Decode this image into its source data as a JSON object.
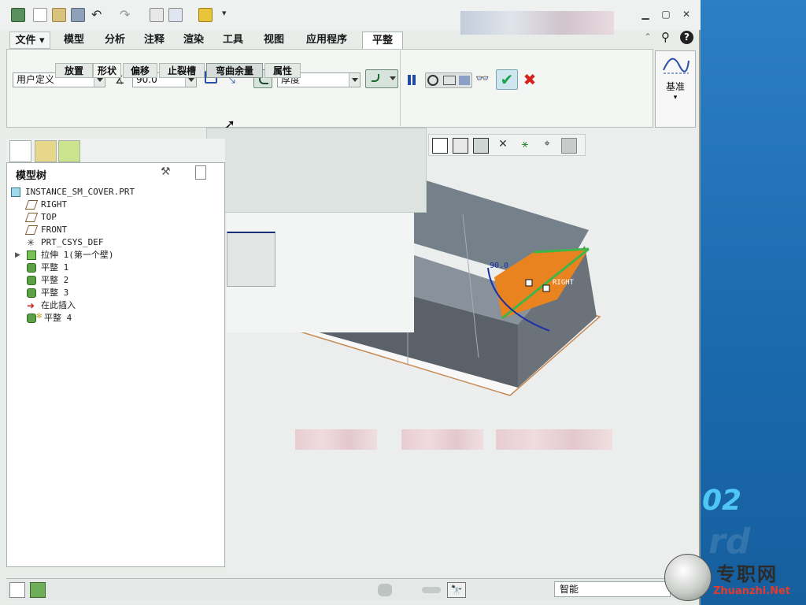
{
  "ribbon": {
    "tabs": [
      {
        "label": "文件",
        "dropdown": true
      },
      {
        "label": "模型"
      },
      {
        "label": "分析"
      },
      {
        "label": "注释"
      },
      {
        "label": "渲染"
      },
      {
        "label": "工具"
      },
      {
        "label": "视图"
      },
      {
        "label": "应用程序"
      },
      {
        "label": "平整",
        "active": true
      }
    ],
    "bend_type_value": "用户定义",
    "angle_value": "90.0",
    "thickness_value": "厚度",
    "subtabs": [
      "放置",
      "形状",
      "偏移",
      "止裂槽",
      "弯曲余量",
      "属性"
    ],
    "datum_label": "基准"
  },
  "model_tree": {
    "title": "模型树",
    "items": [
      {
        "label": "INSTANCE_SM_COVER.PRT",
        "icon": "part-icon"
      },
      {
        "label": "RIGHT",
        "icon": "datum-plane-icon"
      },
      {
        "label": "TOP",
        "icon": "datum-plane-icon"
      },
      {
        "label": "FRONT",
        "icon": "datum-plane-icon"
      },
      {
        "label": "PRT_CSYS_DEF",
        "icon": "csys-icon"
      },
      {
        "label": "拉伸 1(第一个壁)",
        "icon": "extrude-icon",
        "expandable": true
      },
      {
        "label": "平整 1",
        "icon": "flat-wall-icon"
      },
      {
        "label": "平整 2",
        "icon": "flat-wall-icon"
      },
      {
        "label": "平整 3",
        "icon": "flat-wall-icon"
      },
      {
        "label": "在此插入",
        "icon": "insert-here-icon"
      },
      {
        "label": "平整 4",
        "icon": "flat-wall-icon",
        "new": true
      }
    ]
  },
  "graphics": {
    "dim_angle": "90.0",
    "plane_label": "RIGHT"
  },
  "status": {
    "filter_value": "智能"
  },
  "logo": {
    "title": "专职网",
    "url_text": "Zhuanzhi.Net"
  },
  "colors": {
    "accent_ok": "#19a34a",
    "cancel": "#d4231c",
    "highlight_face": "#e8831f",
    "model_face": "#6b727a"
  }
}
